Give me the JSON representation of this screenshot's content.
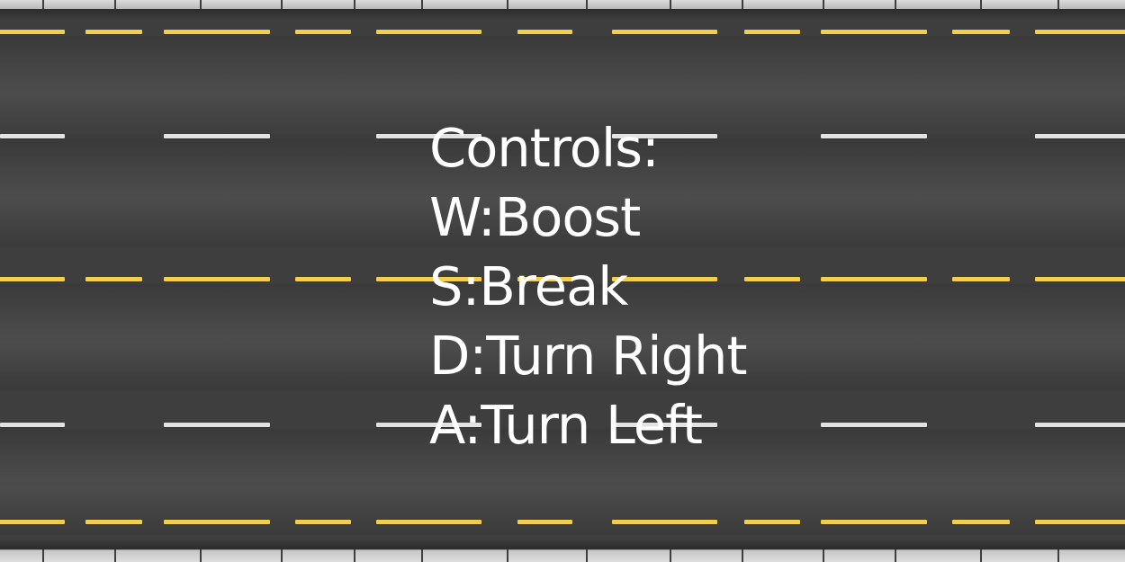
{
  "controls": {
    "title": "Controls:",
    "items": [
      "W:Boost",
      "S:Break",
      "D:Turn Right",
      "A:Turn Left"
    ]
  },
  "colors": {
    "road": "#3e3e3e",
    "lane_yellow": "#f2cf4a",
    "lane_white": "#e2e2e2",
    "curb": "#d0d0d0",
    "text": "#ffffff"
  },
  "road": {
    "lane_line_colors": [
      "yellow",
      "white",
      "yellow",
      "white",
      "yellow"
    ]
  }
}
